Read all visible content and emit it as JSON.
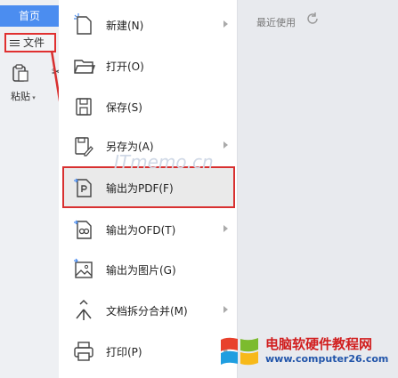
{
  "toolbar": {
    "home_tab": "首页",
    "file_button": "文件",
    "paste_label": "粘贴"
  },
  "menu": {
    "items": [
      {
        "label": "新建(N)",
        "icon": "new-doc-icon",
        "has_submenu": true
      },
      {
        "label": "打开(O)",
        "icon": "folder-icon",
        "has_submenu": false
      },
      {
        "label": "保存(S)",
        "icon": "save-icon",
        "has_submenu": false
      },
      {
        "label": "另存为(A)",
        "icon": "save-as-icon",
        "has_submenu": true
      },
      {
        "label": "输出为PDF(F)",
        "icon": "pdf-icon",
        "has_submenu": false,
        "highlighted": true
      },
      {
        "label": "输出为OFD(T)",
        "icon": "ofd-icon",
        "has_submenu": true
      },
      {
        "label": "输出为图片(G)",
        "icon": "image-export-icon",
        "has_submenu": false
      },
      {
        "label": "文档拆分合并(M)",
        "icon": "split-merge-icon",
        "has_submenu": true
      },
      {
        "label": "打印(P)",
        "icon": "print-icon",
        "has_submenu": true
      }
    ]
  },
  "recent": {
    "title": "最近使用"
  },
  "watermark": "ITmemo.cn",
  "brand": {
    "name": "电脑软硬件教程网",
    "url": "www.computer26.com"
  },
  "colors": {
    "accent": "#4b8df0",
    "highlight_border": "#d83030",
    "brand_red": "#d11e1e",
    "brand_blue": "#2255aa"
  }
}
